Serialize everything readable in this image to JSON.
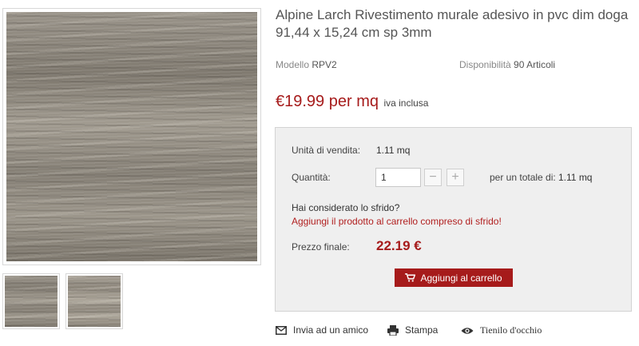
{
  "product": {
    "title": "Alpine Larch Rivestimento murale adesivo in pvc dim doga 91,44 x 15,24 cm sp 3mm",
    "model_label": "Modello",
    "model_value": "RPV2",
    "availability_label": "Disponibilità",
    "availability_value": "90 Articoli",
    "price": "€19.99 per mq",
    "vat_note": "iva inclusa"
  },
  "purchase": {
    "unit_label": "Unità di vendita:",
    "unit_value": "1.11 mq",
    "quantity_label": "Quantità:",
    "quantity_value": "1",
    "minus_symbol": "−",
    "plus_symbol": "+",
    "total_label": "per un totale di:",
    "total_value": "1.11",
    "total_unit": "mq",
    "waste_question": "Hai considerato lo sfrido?",
    "waste_link": "Aggiungi il prodotto al carrello compreso di sfrido!",
    "final_price_label": "Prezzo finale:",
    "final_price_value": "22.19 €",
    "add_to_cart_label": "Aggiungi al carrello"
  },
  "actions": {
    "send_friend": "Invia ad un amico",
    "print": "Stampa",
    "watch": "Tienilo d'occhio"
  },
  "icons": {
    "envelope": "envelope-icon",
    "printer": "printer-icon",
    "eye": "eye-icon",
    "cart": "cart-icon"
  },
  "colors": {
    "accent": "#a61b1b",
    "box_bg": "#efefef"
  }
}
